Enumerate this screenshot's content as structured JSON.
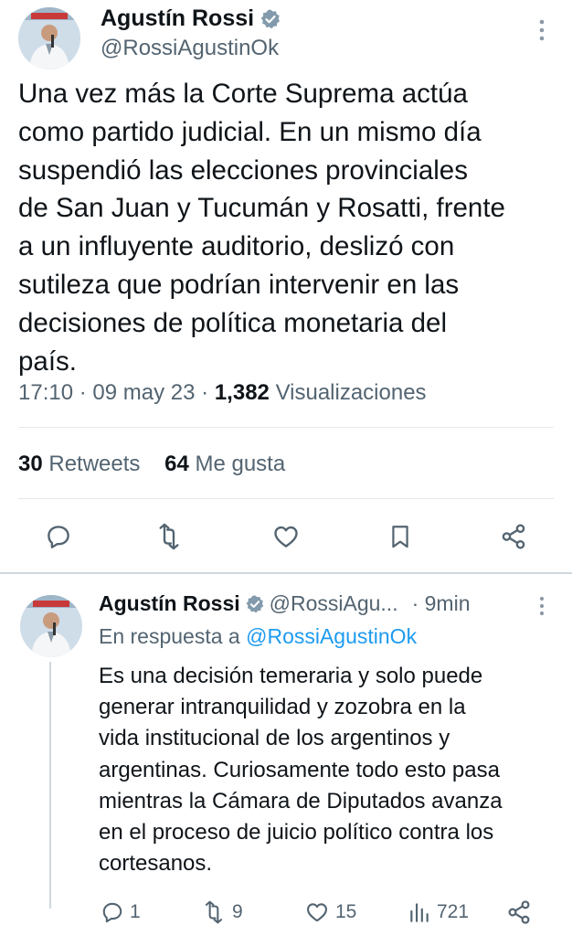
{
  "main_tweet": {
    "author_name": "Agustín Rossi",
    "author_handle": "@RossiAgustinOk",
    "avatar": "profile-photo",
    "text": "Una vez más la Corte Suprema actúa\ncomo partido judicial. En un mismo día\nsuspendió las elecciones provinciales\nde San Juan y Tucumán y Rosatti, frente\na un influyente auditorio, deslizó con\nsutileza que podrían intervenir en las\ndecisiones de política monetaria del\npaís.",
    "time": "17:10",
    "date": "09 may 23",
    "views_count": "1,382",
    "views_label": "Visualizaciones",
    "retweets_count": "30",
    "retweets_label": "Retweets",
    "likes_count": "64",
    "likes_label": "Me gusta",
    "actions": [
      "reply-icon",
      "retweet-icon",
      "like-icon",
      "bookmark-icon",
      "share-icon"
    ]
  },
  "reply_tweet": {
    "author_name": "Agustín Rossi",
    "author_handle": "@RossiAgu...",
    "age": "· 9min",
    "replying_prefix": "En respuesta a",
    "replying_handle": "@RossiAgustinOk",
    "text": "Es una decisión temeraria y solo puede\ngenerar intranquilidad y zozobra en la\nvida institucional de los argentinos y\nargentinas. Curiosamente todo esto pasa\nmientras la Cámara de Diputados avanza\nen el proceso de juicio político contra los\ncortesanos.",
    "reply_count": "1",
    "retweet_count": "9",
    "like_count": "15",
    "view_count": "721"
  },
  "colors": {
    "text": "#0f1419",
    "muted": "#536471",
    "link": "#1d9bf0",
    "verified": "#829aab",
    "divider": "#e6e9ec"
  }
}
